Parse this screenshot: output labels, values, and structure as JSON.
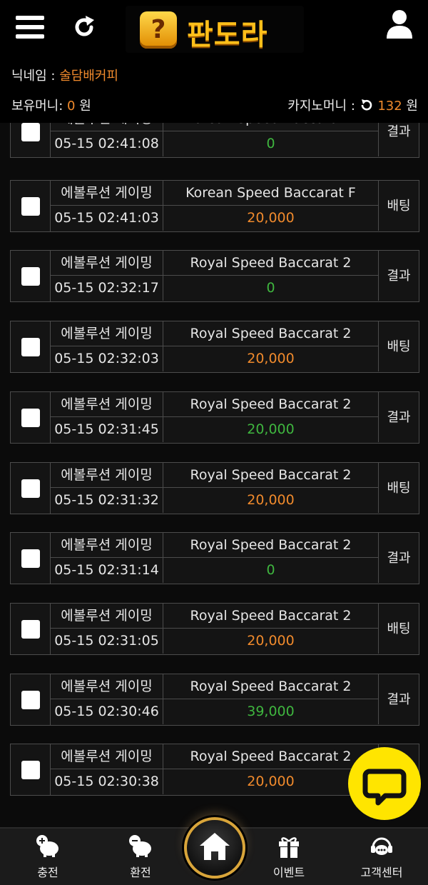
{
  "header": {
    "logo_text": "판도라",
    "logo_mark": "?"
  },
  "info": {
    "nickname_label": "닉네임 : ",
    "nickname_value": "술담배커피",
    "money_label": "보유머니: ",
    "money_value": "0",
    "money_unit": " 원",
    "casino_label": "카지노머니 : ",
    "casino_value": "132",
    "casino_unit": " 원"
  },
  "colors": {
    "accent_orange": "#f08a2c",
    "win_green": "#3fb63f",
    "bet_orange": "#f08a2c",
    "chat_yellow": "#ffe500"
  },
  "rows": [
    {
      "provider": "에볼루션 게이밍",
      "game": "Korean Speed Baccarat F",
      "time": "05-15 02:41:08",
      "amount": "0",
      "amount_color": "#3fb63f",
      "status": "결과"
    },
    {
      "provider": "에볼루션 게이밍",
      "game": "Korean Speed Baccarat F",
      "time": "05-15 02:41:03",
      "amount": "20,000",
      "amount_color": "#f08a2c",
      "status": "배팅"
    },
    {
      "provider": "에볼루션 게이밍",
      "game": "Royal Speed Baccarat 2",
      "time": "05-15 02:32:17",
      "amount": "0",
      "amount_color": "#3fb63f",
      "status": "결과"
    },
    {
      "provider": "에볼루션 게이밍",
      "game": "Royal Speed Baccarat 2",
      "time": "05-15 02:32:03",
      "amount": "20,000",
      "amount_color": "#f08a2c",
      "status": "배팅"
    },
    {
      "provider": "에볼루션 게이밍",
      "game": "Royal Speed Baccarat 2",
      "time": "05-15 02:31:45",
      "amount": "20,000",
      "amount_color": "#3fb63f",
      "status": "결과"
    },
    {
      "provider": "에볼루션 게이밍",
      "game": "Royal Speed Baccarat 2",
      "time": "05-15 02:31:32",
      "amount": "20,000",
      "amount_color": "#f08a2c",
      "status": "배팅"
    },
    {
      "provider": "에볼루션 게이밍",
      "game": "Royal Speed Baccarat 2",
      "time": "05-15 02:31:14",
      "amount": "0",
      "amount_color": "#3fb63f",
      "status": "결과"
    },
    {
      "provider": "에볼루션 게이밍",
      "game": "Royal Speed Baccarat 2",
      "time": "05-15 02:31:05",
      "amount": "20,000",
      "amount_color": "#f08a2c",
      "status": "배팅"
    },
    {
      "provider": "에볼루션 게이밍",
      "game": "Royal Speed Baccarat 2",
      "time": "05-15 02:30:46",
      "amount": "39,000",
      "amount_color": "#3fb63f",
      "status": "결과"
    },
    {
      "provider": "에볼루션 게이밍",
      "game": "Royal Speed Baccarat 2",
      "time": "05-15 02:30:38",
      "amount": "20,000",
      "amount_color": "#f08a2c",
      "status": ""
    }
  ],
  "nav": {
    "deposit": "충전",
    "withdraw": "환전",
    "event": "이벤트",
    "support": "고객센터"
  }
}
